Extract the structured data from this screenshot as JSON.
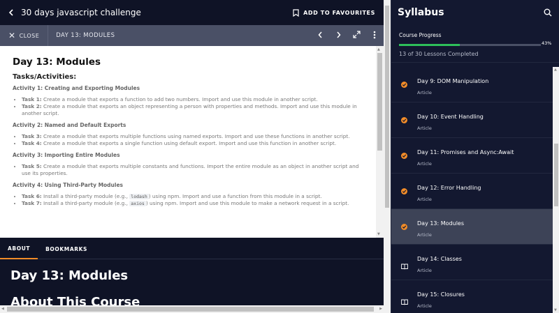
{
  "header": {
    "back_icon": "chevron-left-icon",
    "course_title": "30 days javascript challenge",
    "favourite_label": "ADD TO FAVOURITES"
  },
  "subbar": {
    "close_label": "CLOSE",
    "lesson_label": "DAY 13: MODULES"
  },
  "document": {
    "title": "Day 13: Modules",
    "section_heading": "Tasks/Activities:",
    "activities": [
      {
        "heading": "Activity 1: Creating and Exporting Modules",
        "tasks": [
          {
            "label": "Task 1:",
            "text": "Create a module that exports a function to add two numbers. Import and use this module in another script."
          },
          {
            "label": "Task 2:",
            "text": "Create a module that exports an object representing a person with properties and methods. Import and use this module in another script."
          }
        ]
      },
      {
        "heading": "Activity 2: Named and Default Exports",
        "tasks": [
          {
            "label": "Task 3:",
            "text": "Create a module that exports multiple functions using named exports. Import and use these functions in another script."
          },
          {
            "label": "Task 4:",
            "text": "Create a module that exports a single function using default export. Import and use this function in another script."
          }
        ]
      },
      {
        "heading": "Activity 3: Importing Entire Modules",
        "tasks": [
          {
            "label": "Task 5:",
            "text": "Create a module that exports multiple constants and functions. Import the entire module as an object in another script and use its properties."
          }
        ]
      },
      {
        "heading": "Activity 4: Using Third-Party Modules",
        "tasks": [
          {
            "label": "Task 6:",
            "pre": "Install a third-party module (e.g., ",
            "code": "lodash",
            "post": ") using npm. Import and use a function from this module in a script."
          },
          {
            "label": "Task 7:",
            "pre": "Install a third-party module (e.g., ",
            "code": "axios",
            "post": ") using npm. Import and use this module to make a network request in a script."
          }
        ]
      }
    ]
  },
  "tabs": [
    {
      "label": "ABOUT",
      "active": true
    },
    {
      "label": "BOOKMARKS",
      "active": false
    }
  ],
  "about": {
    "lesson_title": "Day 13: Modules",
    "course_heading": "About This Course"
  },
  "sidebar": {
    "title": "Syllabus",
    "search_icon": "search-icon",
    "progress_label": "Course Progress",
    "progress_percent": 43,
    "progress_percent_label": "43%",
    "completed_text": "13 of 30 Lessons Completed",
    "colors": {
      "accent": "#f28c28",
      "progress": "#2ec05a"
    },
    "lessons": [
      {
        "name": "Day 9: DOM Manipulation",
        "type": "Article",
        "status": "completed",
        "active": false
      },
      {
        "name": "Day 10: Event Handling",
        "type": "Article",
        "status": "completed",
        "active": false
      },
      {
        "name": "Day 11: Promises and Async:Await",
        "type": "Article",
        "status": "completed",
        "active": false
      },
      {
        "name": "Day 12: Error Handling",
        "type": "Article",
        "status": "completed",
        "active": false
      },
      {
        "name": "Day 13: Modules",
        "type": "Article",
        "status": "completed",
        "active": true
      },
      {
        "name": "Day 14: Classes",
        "type": "Article",
        "status": "book",
        "active": false
      },
      {
        "name": "Day 15: Closures",
        "type": "Article",
        "status": "book",
        "active": false
      }
    ]
  }
}
